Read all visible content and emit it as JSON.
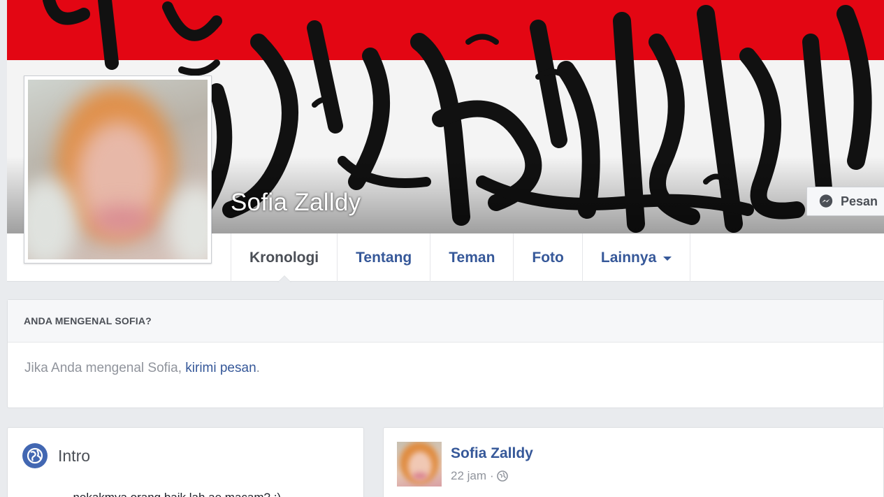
{
  "profile": {
    "name": "Sofia Zalldy",
    "message_button": "Pesan"
  },
  "tabs": [
    {
      "label": "Kronologi",
      "active": true
    },
    {
      "label": "Tentang",
      "active": false
    },
    {
      "label": "Teman",
      "active": false
    },
    {
      "label": "Foto",
      "active": false
    },
    {
      "label": "Lainnya",
      "active": false
    }
  ],
  "know_card": {
    "heading": "ANDA MENGENAL SOFIA?",
    "text_before": "Jika Anda mengenal Sofia, ",
    "link": "kirimi pesan",
    "text_after": "."
  },
  "intro": {
    "title": "Intro",
    "bio": "..nekakmya orang baik lah ae macam? :)"
  },
  "post": {
    "author": "Sofia Zalldy",
    "time": "22 jam",
    "separator": "·"
  },
  "colors": {
    "link": "#365899",
    "cover_red": "#e30613",
    "page_bg": "#e9ebee"
  },
  "icons": {
    "message": "messenger-icon",
    "privacy": "globe-icon",
    "dropdown": "caret-down-icon"
  }
}
